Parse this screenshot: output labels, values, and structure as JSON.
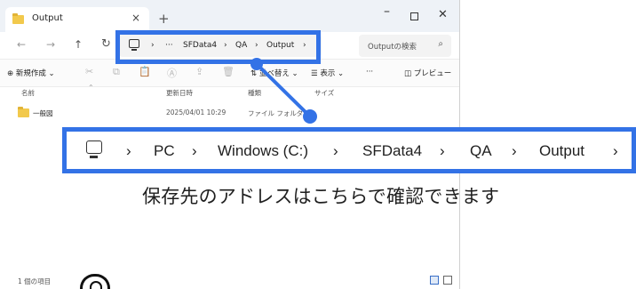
{
  "window": {
    "tab_title": "Output",
    "tab_close": "×",
    "new_tab": "+",
    "minimize": "–",
    "close": "✕"
  },
  "nav": {
    "back": "←",
    "forward": "→",
    "up": "↑",
    "refresh": "↻"
  },
  "address": {
    "chevron": "›",
    "overflow": "···",
    "crumbs": [
      "SFData4",
      "QA",
      "Output"
    ]
  },
  "search": {
    "placeholder": "Outputの検索",
    "icon": "⌕"
  },
  "commands": {
    "new_label": "⊕ 新規作成 ⌄",
    "cut_icon": "✂",
    "copy_icon": "⧉",
    "paste_icon": "📋",
    "rename_icon": "Ⓐ",
    "share_icon": "⇪",
    "delete_icon": "🗑",
    "sort_label": "⇅ 並べ替え ⌄",
    "view_label": "☰ 表示 ⌄",
    "more_label": "···",
    "preview_label": "◫ プレビュー"
  },
  "columns": {
    "name": "名前",
    "date": "更新日時",
    "type": "種類",
    "size": "サイズ",
    "sort_caret": "⌃"
  },
  "files": [
    {
      "name": "一般図",
      "date": "2025/04/01 10:29",
      "type": "ファイル フォルダー"
    }
  ],
  "status": {
    "count": "1 個の項目"
  },
  "zoom": {
    "chevron": "›",
    "crumbs": [
      "PC",
      "Windows (C:)",
      "SFData4",
      "QA",
      "Output"
    ]
  },
  "caption": "保存先のアドレスはこちらで確認できます",
  "colors": {
    "accent": "#3372e6",
    "folder": "#f2c94c"
  }
}
